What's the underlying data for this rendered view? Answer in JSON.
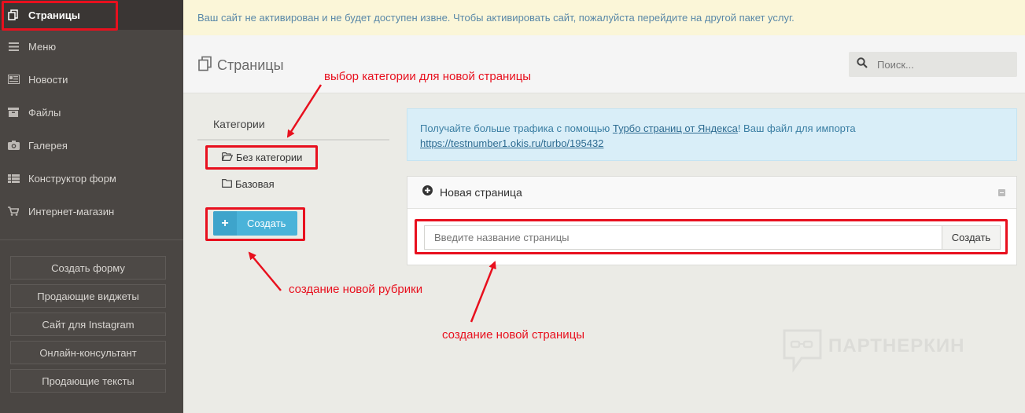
{
  "notice": "Ваш сайт не активирован и не будет доступен извне. Чтобы активировать сайт, пожалуйста перейдите на другой пакет услуг.",
  "sidebar": {
    "items": [
      {
        "label": "Страницы",
        "icon": "pages-icon"
      },
      {
        "label": "Меню",
        "icon": "menu-icon"
      },
      {
        "label": "Новости",
        "icon": "news-icon"
      },
      {
        "label": "Файлы",
        "icon": "files-icon"
      },
      {
        "label": "Галерея",
        "icon": "camera-icon"
      },
      {
        "label": "Конструктор форм",
        "icon": "form-builder-icon"
      },
      {
        "label": "Интернет-магазин",
        "icon": "cart-icon"
      }
    ],
    "buttons": [
      "Создать форму",
      "Продающие виджеты",
      "Сайт для Instagram",
      "Онлайн-консультант",
      "Продающие тексты"
    ]
  },
  "header": {
    "title": "Страницы",
    "search_placeholder": "Поиск..."
  },
  "categories": {
    "title": "Категории",
    "items": [
      "Без категории",
      "Базовая"
    ],
    "create_label": "Создать"
  },
  "info": {
    "text_before": "Получайте больше трафика с помощью ",
    "link_text": "Турбо страниц от Яндекса",
    "text_after": "! Ваш файл для импорта",
    "url": "https://testnumber1.okis.ru/turbo/195432"
  },
  "new_page": {
    "title": "Новая страница",
    "input_placeholder": "Введите название страницы",
    "create_label": "Создать"
  },
  "annotations": {
    "category": "выбор категории для новой страницы",
    "rubric": "создание новой рубрики",
    "page": "создание новой страницы"
  },
  "watermark": "ПАРТНЕРКИН",
  "colors": {
    "highlight": "#e8101e",
    "sidebar_bg": "#4a4643",
    "accent": "#4ab3d9",
    "notice_bg": "#fbf6d8"
  }
}
